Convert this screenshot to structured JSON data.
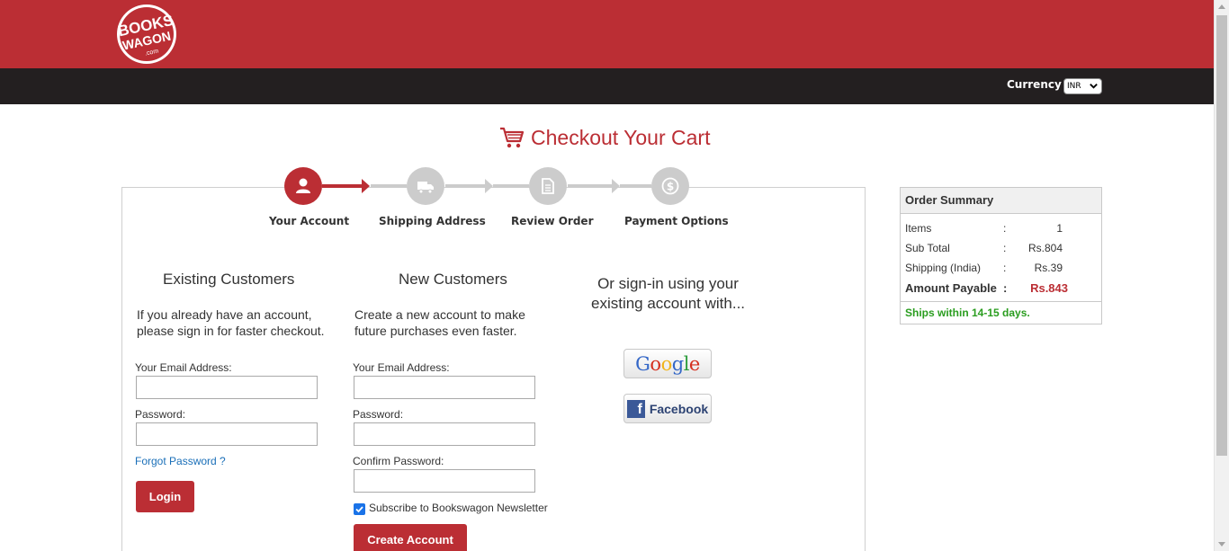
{
  "header": {
    "logo_line1": "BOOKS",
    "logo_line2": "WAGON",
    "logo_line3": ".com",
    "currency_label": "Currency",
    "currency_value": "INR"
  },
  "page_title": "Checkout Your Cart",
  "steps": [
    {
      "label": "Your Account",
      "icon": "user-icon",
      "active": true
    },
    {
      "label": "Shipping Address",
      "icon": "truck-icon",
      "active": false
    },
    {
      "label": "Review Order",
      "icon": "document-icon",
      "active": false
    },
    {
      "label": "Payment Options",
      "icon": "dollar-icon",
      "active": false
    }
  ],
  "existing": {
    "title": "Existing Customers",
    "desc_line1": "If you already have an account,",
    "desc_line2": "please sign in for faster checkout.",
    "email_label": "Your Email Address:",
    "email_value": "",
    "password_label": "Password:",
    "password_value": "",
    "forgot_label": "Forgot Password ?",
    "login_label": "Login"
  },
  "new_customers": {
    "title": "New Customers",
    "desc_line1": "Create a new account to make",
    "desc_line2": "future purchases even faster.",
    "email_label": "Your Email Address:",
    "email_value": "",
    "password_label": "Password:",
    "password_value": "",
    "confirm_label": "Confirm Password:",
    "confirm_value": "",
    "newsletter_label": "Subscribe to Bookswagon Newsletter",
    "newsletter_checked": true,
    "create_label": "Create Account"
  },
  "social": {
    "title_line1": "Or sign-in using your",
    "title_line2": "existing account with...",
    "google_label": "Google",
    "facebook_icon_letter": "f",
    "facebook_label": "Facebook"
  },
  "summary": {
    "title": "Order Summary",
    "rows": [
      {
        "key": "Items",
        "sep": ":",
        "value": "1"
      },
      {
        "key": "Sub Total",
        "sep": ":",
        "value": "Rs.804"
      },
      {
        "key": "Shipping (India)",
        "sep": ":",
        "value": "Rs.39"
      },
      {
        "key": "Amount Payable",
        "sep": ":",
        "value": "Rs.843"
      }
    ],
    "ships_note": "Ships within 14-15 days."
  },
  "colors": {
    "brand_red": "#bb2e34",
    "dark_bar": "#231f20",
    "step_inactive": "#cccccc",
    "success_green": "#2a9d1f",
    "link_blue": "#1a6fb8"
  }
}
